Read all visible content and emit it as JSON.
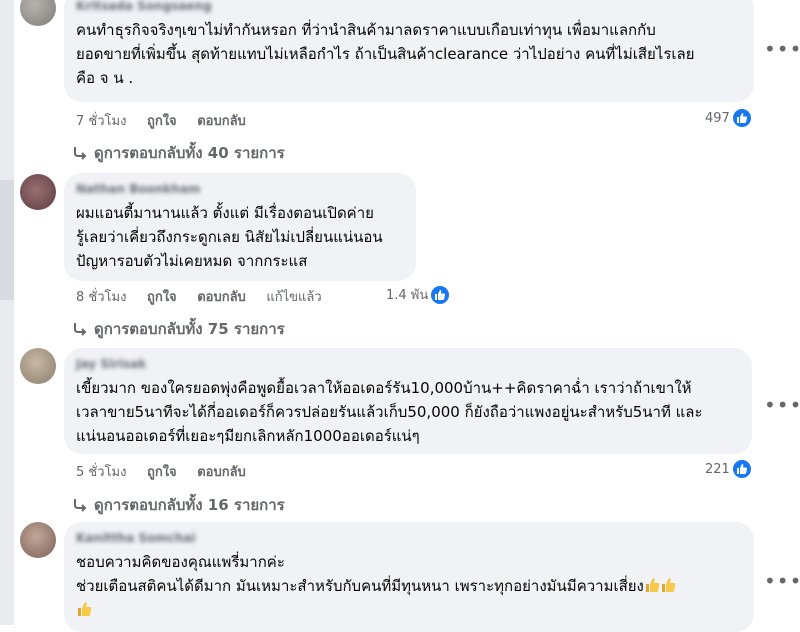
{
  "comments": [
    {
      "author": "Kritsada Songsaeng",
      "lines": [
        "คนทำธุรกิจจริงๆเขาไม่ทำกันหรอก ที่ว่านำสินค้ามาลดราคาแบบเกือบเท่าทุน เพื่อมาแลกกับ",
        "ยอดขายที่เพิ่มขึ้น สุดท้ายแทบไม่เหลือกำไร ถ้าเป็นสินค้าclearance ว่าไปอย่าง คนที่ไม่เสียไรเลย",
        "คือ จ น ."
      ],
      "time": "7 ชั่วโมง",
      "like": "ถูกใจ",
      "reply": "ตอบกลับ",
      "reactions": "497",
      "replies": "ดูการตอบกลับทั้ง 40 รายการ"
    },
    {
      "author": "Nathan Boonkham",
      "lines": [
        "ผมแอนตี้มานานแล้ว ตั้งแต่ มีเรื่องตอนเปิดค่าย",
        "รู้เลยว่าเคี่ยวถึงกระดูกเลย นิสัยไม่เปลี่ยนแน่นอน",
        "ปัญหารอบตัวไม่เคยหมด จากกระแส"
      ],
      "time": "8 ชั่วโมง",
      "like": "ถูกใจ",
      "reply": "ตอบกลับ",
      "edited": "แก้ไขแล้ว",
      "reactions": "1.4 พัน",
      "replies": "ดูการตอบกลับทั้ง 75 รายการ"
    },
    {
      "author": "Jay Sirisak",
      "lines": [
        "เขี้ยวมาก ของใครยอดพุ่งคือพูดยื้อเวลาให้ออเดอร์รัน10,000บ้าน++คิดราคาฉ่ำ เราว่าถ้าเขาให้",
        "เวลาขาย5นาทีจะได้กี่ออเดอร์ก็ควรปล่อยรันแล้วเก็บ50,000 ก็ยังถือว่าแพงอยู่นะสำหรับ5นาที และ",
        "แน่นอนออเดอร์ที่เยอะๆมียกเลิกหลัก1000ออเดอร์แน่ๆ"
      ],
      "time": "5 ชั่วโมง",
      "like": "ถูกใจ",
      "reply": "ตอบกลับ",
      "reactions": "221",
      "replies": "ดูการตอบกลับทั้ง 16 รายการ"
    },
    {
      "author": "Kanittha Somchai",
      "lines": [
        "ชอบความคิดของคุณแพรี่มากค่ะ",
        "ช่วยเตือนสติคนได้ดีมาก มันเหมาะสำหรับกับคนที่มีทุนหนา เพราะทุกอย่างมันมีความเสี่ยง"
      ],
      "emoji": "thumbs-up"
    }
  ],
  "colors": {
    "bubble": "#f0f2f5",
    "like_blue": "#1877f2",
    "secondary_text": "#65676b",
    "emoji_yellow": "#f7c948"
  },
  "icons": {
    "more": "more-options-icon",
    "like": "like-reaction-icon",
    "reply_arrow": "reply-arrow-icon",
    "emoji": "thumbs-up-emoji-icon"
  }
}
